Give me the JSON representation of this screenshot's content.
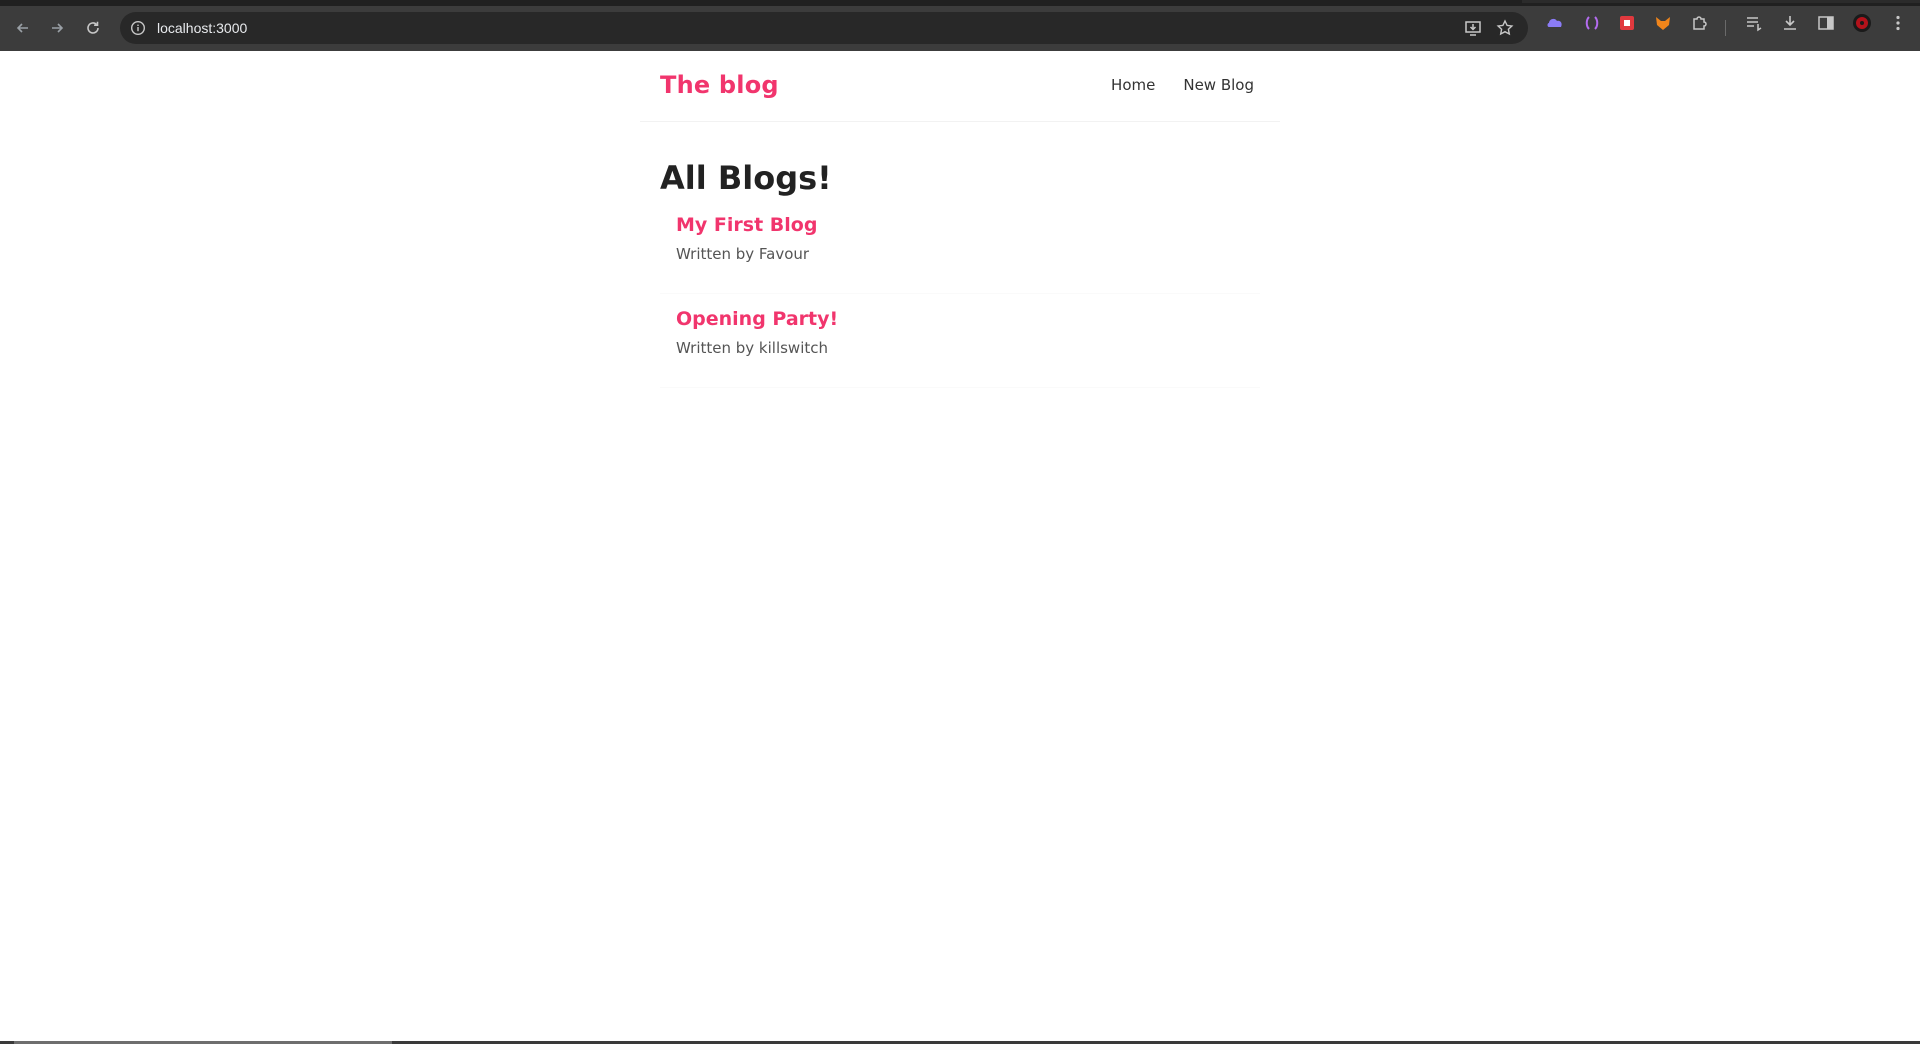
{
  "browser": {
    "url": "localhost:3000",
    "back_icon": "arrow-left-icon",
    "forward_icon": "arrow-right-icon",
    "reload_icon": "reload-icon",
    "site_info_icon": "info-icon",
    "omnibox_icons": [
      "install-app-icon",
      "bookmark-star-icon"
    ],
    "extension_icons": [
      "cloud-extension-icon",
      "bracket-extension-icon",
      "red-extension-icon",
      "fox-extension-icon",
      "puzzle-extension-icon"
    ],
    "toolbar_icons": [
      "reading-list-icon",
      "download-icon",
      "side-panel-icon",
      "profile-avatar-icon",
      "menu-kebab-icon"
    ],
    "colors": {
      "chrome_bg": "#3c3c3c",
      "omnibox_bg": "#282828"
    }
  },
  "navbar": {
    "brand": "The blog",
    "links": [
      {
        "label": "Home"
      },
      {
        "label": "New Blog"
      }
    ]
  },
  "main": {
    "heading": "All Blogs!",
    "blogs": [
      {
        "title": "My First Blog",
        "author_line": "Written by Favour"
      },
      {
        "title": "Opening Party!",
        "author_line": "Written by killswitch"
      }
    ]
  },
  "colors": {
    "accent": "#f1356d",
    "heading_text": "#222222",
    "body_text": "#555555"
  }
}
